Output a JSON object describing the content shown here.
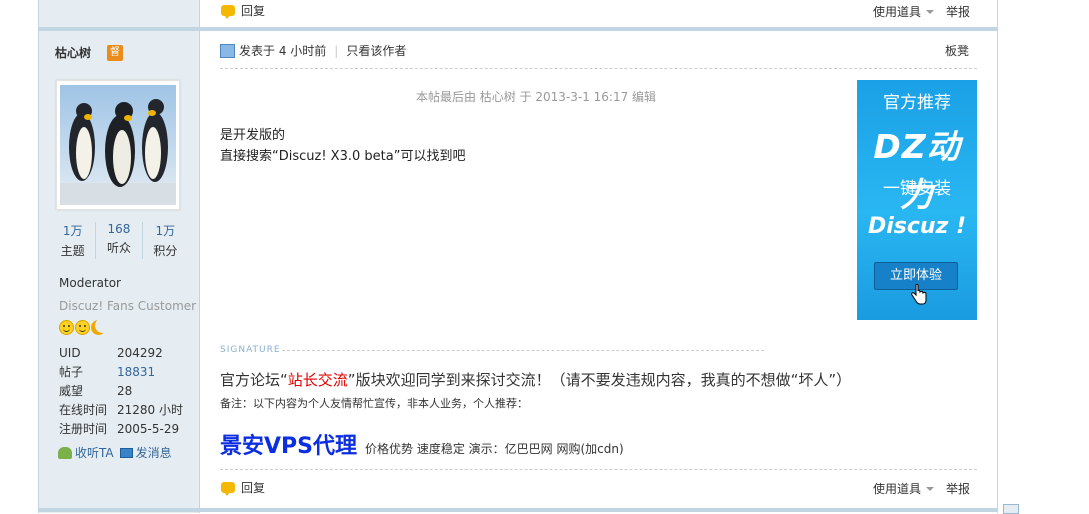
{
  "top_bar": {
    "reply_label": "回复",
    "tools_label": "使用道具",
    "report_label": "举报"
  },
  "author": {
    "name": "枯心树",
    "badge": "督",
    "stats": [
      {
        "value": "1万",
        "label": "主题"
      },
      {
        "value": "168",
        "label": "听众"
      },
      {
        "value": "1万",
        "label": "积分"
      }
    ],
    "group": "Moderator",
    "custom_title": "Discuz! Fans Customer",
    "info": [
      {
        "key": "UID",
        "value": "204292"
      },
      {
        "key": "帖子",
        "value": "18831"
      },
      {
        "key": "威望",
        "value": "28"
      },
      {
        "key": "在线时间",
        "value": "21280 小时"
      },
      {
        "key": "注册时间",
        "value": "2005-5-29"
      }
    ],
    "follow_label": "收听TA",
    "message_label": "发消息"
  },
  "post": {
    "posted": "发表于 4 小时前",
    "only_author": "只看该作者",
    "floor": "板凳",
    "edit_note": "本帖最后由 枯心树 于 2013-3-1 16:17 编辑",
    "lines": [
      "是开发版的",
      "直接搜索“Discuz! X3.0 beta”可以找到吧"
    ]
  },
  "ad": {
    "line1": "官方推荐",
    "line2": "DZ动力",
    "line3": "一键安装",
    "line4": "Discuz !",
    "button": "立即体验",
    "bg_color": "#29b7f2"
  },
  "signature": {
    "label": "SIGNATURE",
    "line1_pre": "官方论坛“",
    "line1_link": "站长交流",
    "line1_post": "”版块欢迎同学到来探讨交流！（请不要发违规内容，我真的不想做“坏人”）",
    "line2": "备注：以下内容为个人友情帮忙宣传，非本人业务，个人推荐：",
    "big": "景安VPS代理",
    "small": "价格优势 速度稳定 演示：亿巴巴网 网购(加cdn)"
  },
  "bottom_bar": {
    "reply_label": "回复",
    "tools_label": "使用道具",
    "report_label": "举报"
  }
}
